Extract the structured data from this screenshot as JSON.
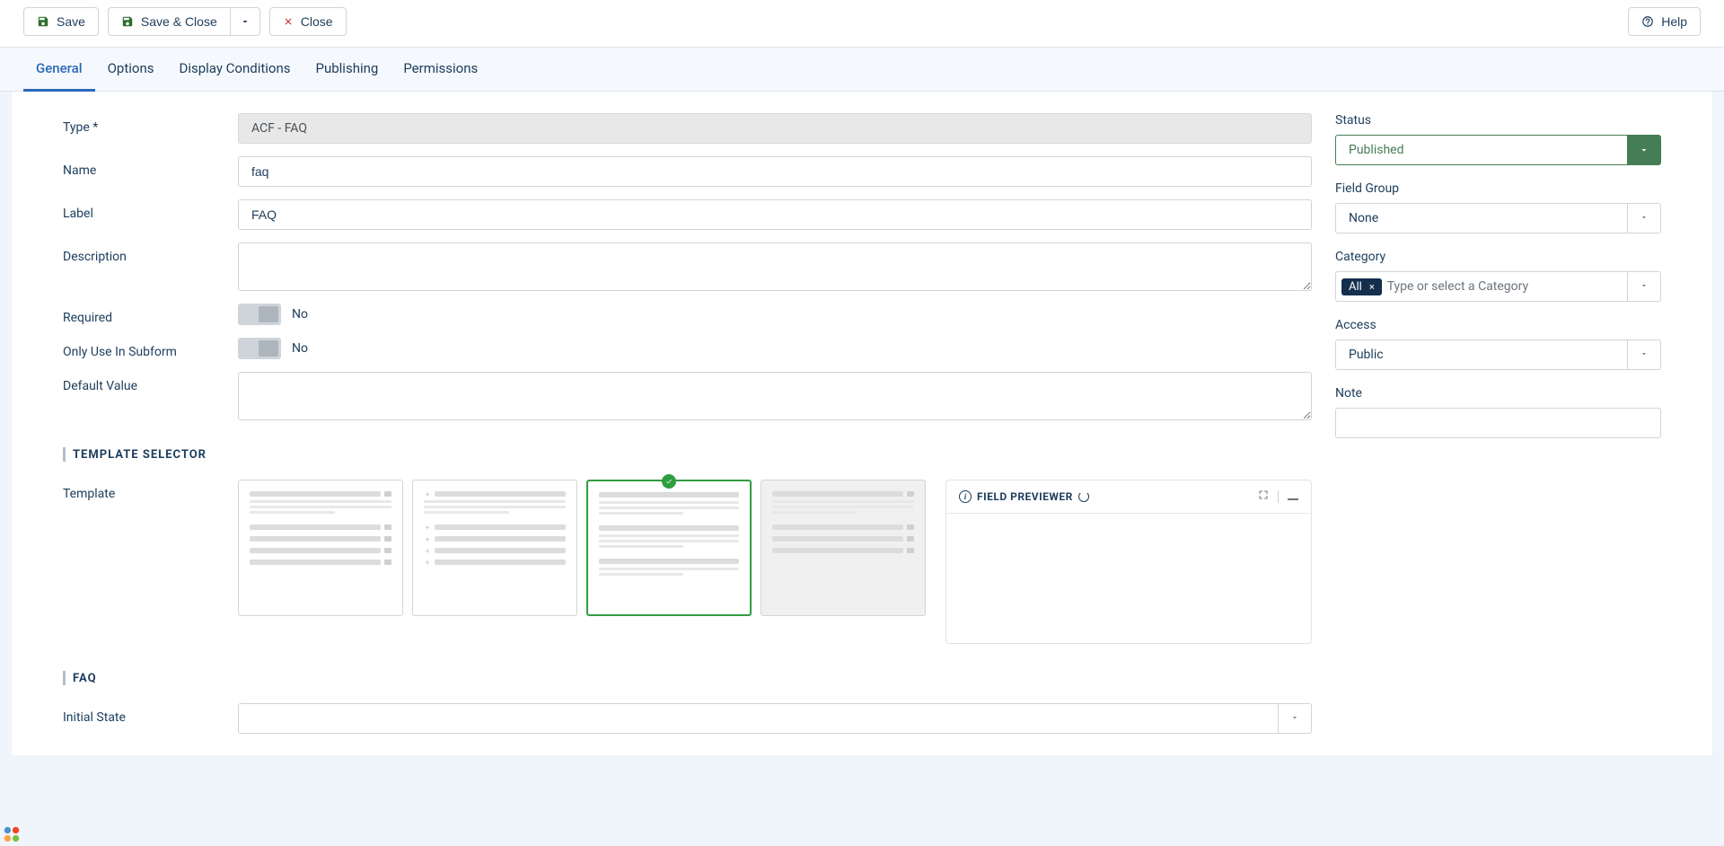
{
  "toolbar": {
    "save": "Save",
    "save_close": "Save & Close",
    "close": "Close",
    "help": "Help"
  },
  "tabs": {
    "general": "General",
    "options": "Options",
    "display_conditions": "Display Conditions",
    "publishing": "Publishing",
    "permissions": "Permissions"
  },
  "labels": {
    "type": "Type *",
    "name": "Name",
    "label": "Label",
    "description": "Description",
    "required": "Required",
    "only_subform": "Only Use In Subform",
    "default_value": "Default Value",
    "template": "Template",
    "initial_state": "Initial State"
  },
  "values": {
    "type": "ACF - FAQ",
    "name": "faq",
    "label": "FAQ",
    "description": "",
    "required": "No",
    "only_subform": "No",
    "default_value": ""
  },
  "sections": {
    "template_selector": "TEMPLATE SELECTOR",
    "faq": "FAQ"
  },
  "sidebar": {
    "status_label": "Status",
    "status_value": "Published",
    "field_group_label": "Field Group",
    "field_group_value": "None",
    "category_label": "Category",
    "category_tag": "All",
    "category_placeholder": "Type or select a Category",
    "access_label": "Access",
    "access_value": "Public",
    "note_label": "Note",
    "note_value": ""
  },
  "previewer": {
    "title": "FIELD PREVIEWER"
  }
}
